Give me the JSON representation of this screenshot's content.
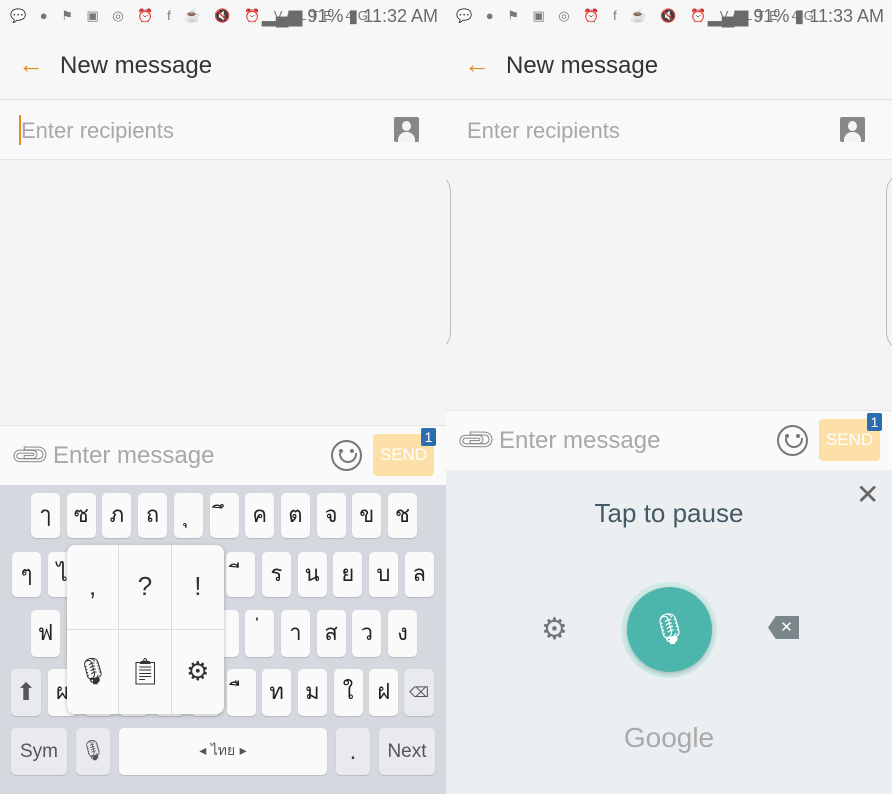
{
  "left": {
    "status": {
      "icons": "💬 ● ⚑ ▣ ◎ ⏰ f ☕  🔇 ⏰ VoLTE 4G",
      "battery": "91%",
      "time": "11:32 AM"
    },
    "header": {
      "title": "New message",
      "back_icon": "arrow-left-icon"
    },
    "recipients": {
      "placeholder": "Enter recipients"
    },
    "message": {
      "placeholder": "Enter message",
      "send_label": "SEND",
      "badge": "1"
    },
    "keyboard": {
      "row1": [
        "ๅ",
        "ซ",
        "ภ",
        "ถ",
        "ุ",
        "ึ",
        "ค",
        "ต",
        "จ",
        "ข",
        "ช"
      ],
      "row2": [
        "ๆ",
        "ไ",
        "",
        "",
        "",
        "",
        "ี",
        "ร",
        "น",
        "ย",
        "บ",
        "ล"
      ],
      "row3": [
        "ฟ",
        "",
        "",
        "",
        "",
        "",
        "่",
        "า",
        "ส",
        "ว",
        "ง"
      ],
      "row4": [
        "ผ",
        "",
        "",
        "",
        "",
        "ื",
        "ท",
        "ม",
        "ใ",
        "ฝ"
      ],
      "sym_label": "Sym",
      "space_label": "ไทย",
      "period_label": ".",
      "next_label": "Next",
      "popup": {
        "comma": ",",
        "question": "?",
        "exclaim": "!"
      }
    }
  },
  "right": {
    "status": {
      "icons": "💬 ● ⚑ ▣ ◎ ⏰ f ☕  🔇 ⏰ VoLTE 4G",
      "battery": "91%",
      "time": "11:33 AM"
    },
    "header": {
      "title": "New message"
    },
    "recipients": {
      "placeholder": "Enter recipients"
    },
    "message": {
      "placeholder": "Enter message",
      "send_label": "SEND",
      "badge": "1"
    },
    "voice": {
      "prompt": "Tap to pause",
      "brand": "Google",
      "accent": "#4db6ac"
    }
  }
}
